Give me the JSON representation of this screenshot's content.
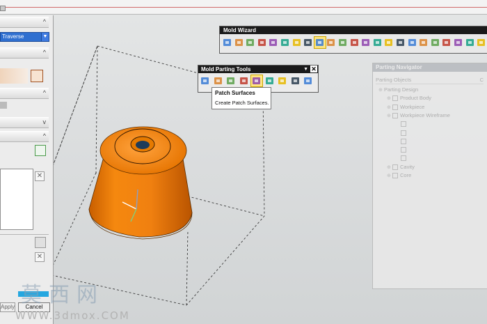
{
  "left_dialog": {
    "type_filter": "Traverse",
    "cancel_label": "Cancel",
    "apply_label": "Apply"
  },
  "mold_wizard": {
    "title": "Mold Wizard",
    "tools": [
      "project-init-icon",
      "family-icon",
      "csys-icon",
      "shrinkage-icon",
      "workpiece-icon",
      "layout-icon",
      "parting-icon",
      "mold-base-icon",
      "standard-parts-icon",
      "ejector-pin-icon",
      "post-process-icon",
      "slider-icon",
      "insert-icon",
      "gate-icon",
      "runner-icon",
      "cooling-icon",
      "electrode-icon",
      "trim-icon",
      "pocket-icon",
      "bom-icon",
      "drawing-icon",
      "view-manager-icon",
      "delete-icon"
    ]
  },
  "mold_parting_tools": {
    "title": "Mold Parting Tools",
    "tools": [
      "region-analysis-icon",
      "mold-check-icon",
      "split-face-icon",
      "define-region-icon",
      "patch-surfaces-icon",
      "parting-surface-icon",
      "define-cavity-core-icon",
      "swap-model-icon",
      "backup-parting-icon"
    ]
  },
  "tooltip": {
    "title": "Patch Surfaces",
    "body": "Create Patch Surfaces."
  },
  "parting_navigator": {
    "title": "Parting Navigator",
    "column_header": "Parting Objects",
    "column_header_right": "C",
    "tree": [
      {
        "label": "Parting Design",
        "level": 0
      },
      {
        "label": "Product Body",
        "level": 1
      },
      {
        "label": "Workpiece",
        "level": 1
      },
      {
        "label": "Workpiece Wireframe",
        "level": 1
      },
      {
        "label": "",
        "level": 2
      },
      {
        "label": "",
        "level": 2
      },
      {
        "label": "",
        "level": 2
      },
      {
        "label": "",
        "level": 2
      },
      {
        "label": "",
        "level": 2
      },
      {
        "label": "Cavity",
        "level": 1
      },
      {
        "label": "Core",
        "level": 1
      }
    ]
  },
  "watermark": {
    "chars": "莫西网",
    "url": "WWW.3dmox.COM"
  },
  "colors": {
    "part_orange": "#f07f0c",
    "toolbar_title_bg": "#1a1a1a",
    "selection_blue": "#2f6fd0"
  }
}
